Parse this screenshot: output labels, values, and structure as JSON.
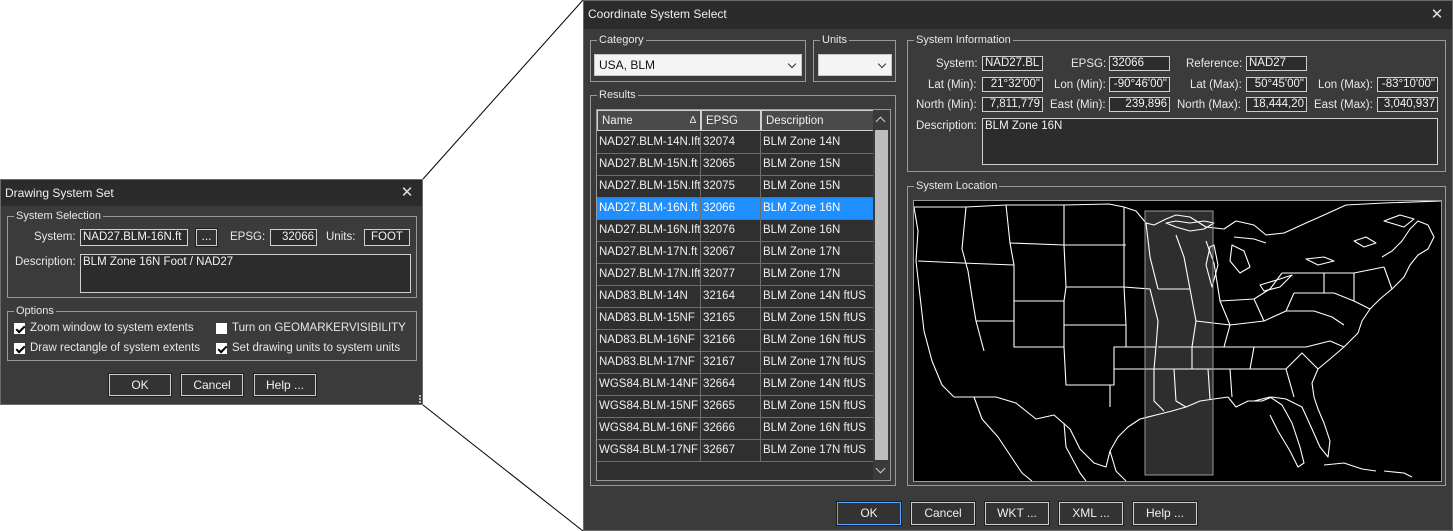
{
  "drawing_dialog": {
    "title": "Drawing System Set",
    "system_selection": {
      "group_title": "System Selection",
      "system_label": "System:",
      "system_value": "NAD27.BLM-16N.ft",
      "browse_label": "...",
      "epsg_label": "EPSG:",
      "epsg_value": "32066",
      "units_label": "Units:",
      "units_value": "FOOT",
      "description_label": "Description:",
      "description_value": "BLM Zone 16N Foot / NAD27"
    },
    "options": {
      "group_title": "Options",
      "items": [
        {
          "label": "Zoom window to system extents",
          "checked": true
        },
        {
          "label": "Turn on GEOMARKERVISIBILITY",
          "checked": false
        },
        {
          "label": "Draw rectangle of system extents",
          "checked": true
        },
        {
          "label": "Set drawing units to system units",
          "checked": true
        }
      ]
    },
    "buttons": {
      "ok": "OK",
      "cancel": "Cancel",
      "help": "Help ..."
    }
  },
  "coord_dialog": {
    "title": "Coordinate System Select",
    "category": {
      "group_title": "Category",
      "value": "USA, BLM"
    },
    "units": {
      "group_title": "Units",
      "value": ""
    },
    "results": {
      "group_title": "Results",
      "columns": [
        "Name",
        "EPSG",
        "Description"
      ],
      "rows": [
        {
          "name": "NAD27.BLM-14N.Ift",
          "epsg": "32074",
          "desc": "BLM Zone 14N",
          "selected": false
        },
        {
          "name": "NAD27.BLM-15N.ft",
          "epsg": "32065",
          "desc": "BLM Zone 15N",
          "selected": false
        },
        {
          "name": "NAD27.BLM-15N.Ift",
          "epsg": "32075",
          "desc": "BLM Zone 15N",
          "selected": false
        },
        {
          "name": "NAD27.BLM-16N.ft",
          "epsg": "32066",
          "desc": "BLM Zone 16N",
          "selected": true
        },
        {
          "name": "NAD27.BLM-16N.Ift",
          "epsg": "32076",
          "desc": "BLM Zone 16N",
          "selected": false
        },
        {
          "name": "NAD27.BLM-17N.ft",
          "epsg": "32067",
          "desc": "BLM Zone 17N",
          "selected": false
        },
        {
          "name": "NAD27.BLM-17N.Ift",
          "epsg": "32077",
          "desc": "BLM Zone 17N",
          "selected": false
        },
        {
          "name": "NAD83.BLM-14N",
          "epsg": "32164",
          "desc": "BLM Zone 14N ftUS",
          "selected": false
        },
        {
          "name": "NAD83.BLM-15NF",
          "epsg": "32165",
          "desc": "BLM Zone 15N ftUS",
          "selected": false
        },
        {
          "name": "NAD83.BLM-16NF",
          "epsg": "32166",
          "desc": "BLM Zone 16N ftUS",
          "selected": false
        },
        {
          "name": "NAD83.BLM-17NF",
          "epsg": "32167",
          "desc": "BLM Zone 17N ftUS",
          "selected": false
        },
        {
          "name": "WGS84.BLM-14NF",
          "epsg": "32664",
          "desc": "BLM Zone 14N ftUS",
          "selected": false
        },
        {
          "name": "WGS84.BLM-15NF",
          "epsg": "32665",
          "desc": "BLM Zone 15N ftUS",
          "selected": false
        },
        {
          "name": "WGS84.BLM-16NF",
          "epsg": "32666",
          "desc": "BLM Zone 16N ftUS",
          "selected": false
        },
        {
          "name": "WGS84.BLM-17NF",
          "epsg": "32667",
          "desc": "BLM Zone 17N ftUS",
          "selected": false
        }
      ]
    },
    "system_info": {
      "group_title": "System Information",
      "system_label": "System:",
      "system_value": "NAD27.BL",
      "epsg_label": "EPSG:",
      "epsg_value": "32066",
      "reference_label": "Reference:",
      "reference_value": "NAD27",
      "lat_min_label": "Lat (Min):",
      "lat_min_value": "21°32'00\"",
      "lon_min_label": "Lon (Min):",
      "lon_min_value": "-90°46'00\"",
      "lat_max_label": "Lat (Max):",
      "lat_max_value": "50°45'00\"",
      "lon_max_label": "Lon (Max):",
      "lon_max_value": "-83°10'00\"",
      "north_min_label": "North (Min):",
      "north_min_value": "7,811,779",
      "east_min_label": "East (Min):",
      "east_min_value": "239,896",
      "north_max_label": "North (Max):",
      "north_max_value": "18,444,20",
      "east_max_label": "East (Max):",
      "east_max_value": "3,040,937",
      "description_label": "Description:",
      "description_value": "BLM Zone 16N"
    },
    "system_location": {
      "group_title": "System Location"
    },
    "buttons": {
      "ok": "OK",
      "cancel": "Cancel",
      "wkt": "WKT ...",
      "xml": "XML ...",
      "help": "Help ..."
    }
  }
}
